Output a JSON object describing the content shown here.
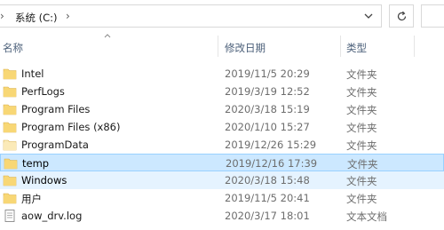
{
  "address": {
    "crumb": "系统 (C:)"
  },
  "columns": {
    "name": "名称",
    "date": "修改日期",
    "type": "类型"
  },
  "rows": [
    {
      "name": "Intel",
      "date": "2019/11/5 20:29",
      "type": "文件夹",
      "kind": "folder"
    },
    {
      "name": "PerfLogs",
      "date": "2019/3/19 12:52",
      "type": "文件夹",
      "kind": "folder"
    },
    {
      "name": "Program Files",
      "date": "2020/3/18 15:19",
      "type": "文件夹",
      "kind": "folder"
    },
    {
      "name": "Program Files (x86)",
      "date": "2020/1/10 15:27",
      "type": "文件夹",
      "kind": "folder"
    },
    {
      "name": "ProgramData",
      "date": "2019/12/26 15:29",
      "type": "文件夹",
      "kind": "folder-hidden"
    },
    {
      "name": "temp",
      "date": "2019/12/16 17:39",
      "type": "文件夹",
      "kind": "folder",
      "state": "selected"
    },
    {
      "name": "Windows",
      "date": "2020/3/18 15:48",
      "type": "文件夹",
      "kind": "folder",
      "state": "hover"
    },
    {
      "name": "用户",
      "date": "2019/11/5 20:41",
      "type": "文件夹",
      "kind": "folder"
    },
    {
      "name": "aow_drv.log",
      "date": "2020/3/17 18:01",
      "type": "文本文档",
      "kind": "text-file"
    }
  ],
  "colors": {
    "folder": "#f8d775",
    "folder_hidden": "#fbeab8",
    "selected_bg": "#cce8ff",
    "hover_bg": "#e5f3ff"
  }
}
